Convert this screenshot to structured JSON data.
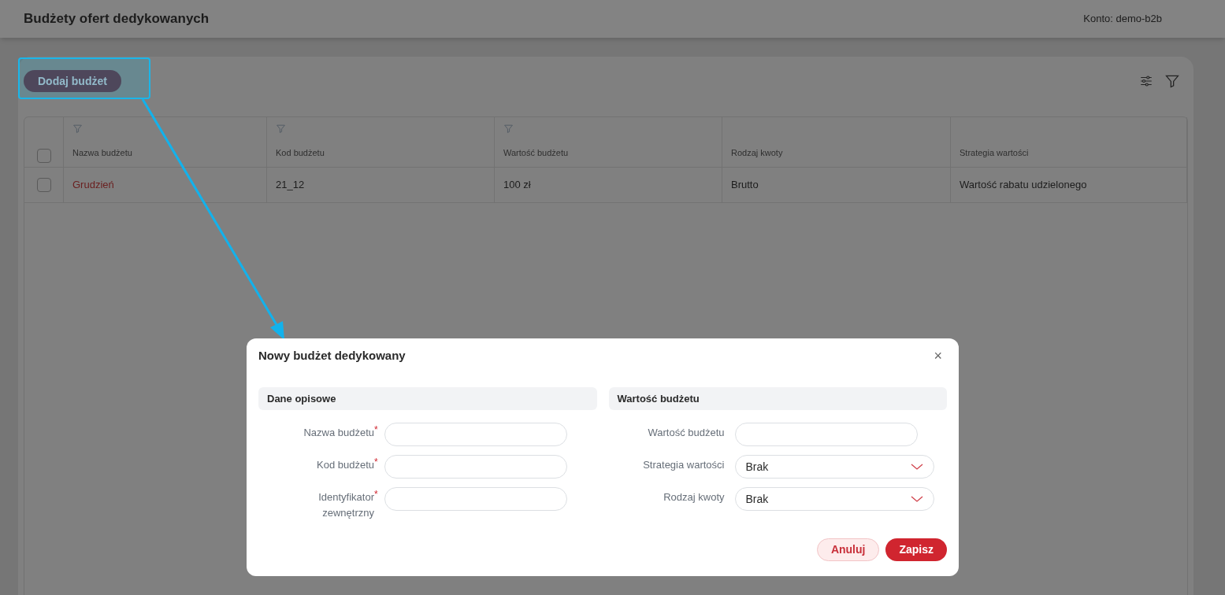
{
  "header": {
    "title": "Budżety ofert dedykowanych",
    "account": "Konto: demo-b2b"
  },
  "toolbar": {
    "add_button": "Dodaj budżet"
  },
  "table": {
    "select_all_checked": false,
    "columns": [
      {
        "label": "Nazwa budżetu",
        "filter": true
      },
      {
        "label": "Kod budżetu",
        "filter": true
      },
      {
        "label": "Wartość budżetu",
        "filter": true
      },
      {
        "label": "Rodzaj kwoty",
        "filter": false
      },
      {
        "label": "Strategia wartości",
        "filter": false
      }
    ],
    "rows": [
      {
        "checked": false,
        "cells": [
          "Grudzień",
          "21_12",
          "100 zł",
          "Brutto",
          "Wartość rabatu udzielonego"
        ]
      }
    ]
  },
  "modal": {
    "title": "Nowy budżet dedykowany",
    "close": "×",
    "required_mark": "*",
    "sections": [
      {
        "title": "Dane opisowe",
        "fields": [
          {
            "label": "Nazwa budżetu",
            "required": true,
            "kind": "input"
          },
          {
            "label": "Kod budżetu",
            "required": true,
            "kind": "input"
          },
          {
            "label": "Identyfikator zewnętrzny",
            "required": true,
            "kind": "input"
          }
        ]
      },
      {
        "title": "Wartość budżetu",
        "fields": [
          {
            "label": "Wartość budżetu",
            "required": false,
            "kind": "input"
          },
          {
            "label": "Strategia wartości",
            "required": false,
            "kind": "select",
            "value": "Brak"
          },
          {
            "label": "Rodzaj kwoty",
            "required": false,
            "kind": "select",
            "value": "Brak"
          }
        ]
      }
    ],
    "buttons": [
      {
        "label": "Anuluj",
        "kind": "secondary"
      },
      {
        "label": "Zapisz",
        "kind": "primary"
      }
    ]
  }
}
